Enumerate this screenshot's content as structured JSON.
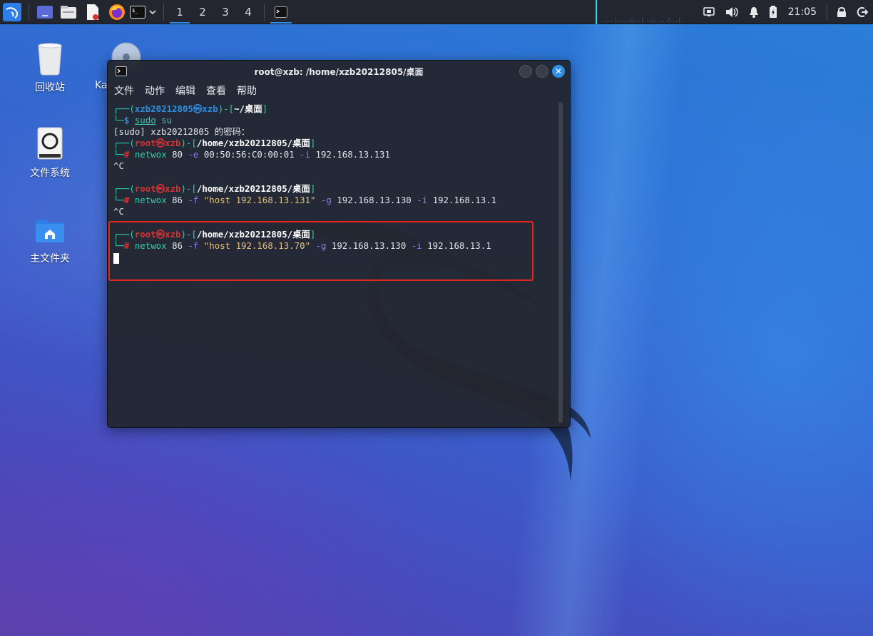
{
  "colors": {
    "accent": "#2d8fe8",
    "taskbar_bg": "#23262e",
    "terminal_bg": "#232730",
    "annotation_red": "#e5261f"
  },
  "taskbar": {
    "workspaces": [
      "1",
      "2",
      "3",
      "4"
    ],
    "active_workspace": "1",
    "clock": "21:05",
    "launcher_icons": [
      "kali-menu-icon",
      "show-desktop-icon",
      "file-manager-icon",
      "text-editor-icon",
      "firefox-icon",
      "terminal-icon",
      "chevron-down-icon"
    ],
    "tray_icons": [
      "network-icon",
      "volume-icon",
      "notification-bell-icon",
      "battery-icon",
      "lock-icon",
      "logout-icon"
    ]
  },
  "desktop": {
    "icons": [
      {
        "label": "回收站",
        "icon": "trash-icon"
      },
      {
        "label": "Kal",
        "icon": "disc-icon"
      },
      {
        "label": "文件系统",
        "icon": "filesystem-icon"
      },
      {
        "label": "主文件夹",
        "icon": "home-folder-icon"
      }
    ]
  },
  "terminal": {
    "title": "root@xzb: /home/xzb20212805/桌面",
    "menu": [
      "文件",
      "动作",
      "编辑",
      "查看",
      "帮助"
    ],
    "lines": {
      "l1_user": "xzb20212805",
      "l1_sep": "㉿",
      "l1_host": "xzb",
      "l1_path": "~/桌面",
      "l2_cmd": "sudo",
      "l2_arg": " su",
      "l3": "[sudo] xzb20212805 的密码：",
      "root": "root",
      "sep": "㉿",
      "host": "xzb",
      "path": "/home/xzb20212805/桌面",
      "cmd1_prog": "netwox",
      "cmd1_a": " 80 ",
      "cmd1_o1": "-e",
      "cmd1_b": " 00:50:56:C0:00:01 ",
      "cmd1_o2": "-i",
      "cmd1_c": " 192.168.13.131",
      "ctrlc": "^C",
      "cmd2_prog": "netwox",
      "cmd2_a": " 86 ",
      "cmd2_o1": "-f",
      "cmd2_str": " \"host 192.168.13.131\" ",
      "cmd2_o2": "-g",
      "cmd2_b": " 192.168.13.130 ",
      "cmd2_o3": "-i",
      "cmd2_c": " 192.168.13.1",
      "cmd3_prog": "netwox",
      "cmd3_a": " 86 ",
      "cmd3_o1": "-f",
      "cmd3_str": " \"host 192.168.13.70\" ",
      "cmd3_o2": "-g",
      "cmd3_b": " 192.168.13.130 ",
      "cmd3_o3": "-i",
      "cmd3_c": " 192.168.13.1"
    }
  }
}
